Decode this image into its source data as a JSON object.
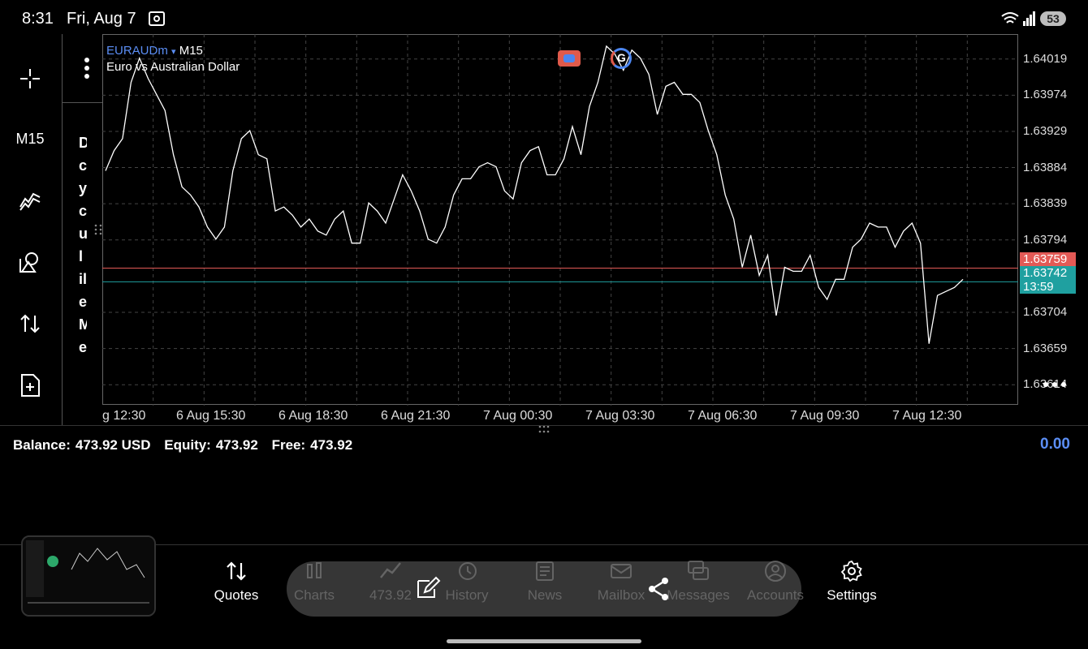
{
  "status_bar": {
    "time": "8:31",
    "date": "Fri, Aug 7",
    "battery": "53"
  },
  "left_toolbar": {
    "timeframe": "M15",
    "tools": [
      "crosshair-icon",
      "indicators-icon",
      "objects-icon",
      "trade-icon",
      "new-document-icon"
    ]
  },
  "side_panel": {
    "clipped_text": "D c y c u l il e M e"
  },
  "chart": {
    "symbol": "EURAUDm",
    "symbol_arrow": "▾",
    "timeframe": "M15",
    "description": "Euro vs Australian Dollar",
    "price_labels": [
      "1.64019",
      "1.63974",
      "1.63929",
      "1.63884",
      "1.63839",
      "1.63794",
      "1.63704",
      "1.63659",
      "1.63614"
    ],
    "ask_price": "1.63759",
    "bid_price": "1.63742",
    "countdown": "13:59",
    "time_labels": [
      "g 12:30",
      "6 Aug 15:30",
      "6 Aug 18:30",
      "6 Aug 21:30",
      "7 Aug 00:30",
      "7 Aug 03:30",
      "7 Aug 06:30",
      "7 Aug 09:30",
      "7 Aug 12:30"
    ],
    "colors": {
      "line": "#ffffff",
      "ask_line": "#e35a56",
      "bid_line": "#1fa0a0",
      "grid": "#444444",
      "symbol": "#5b8ef5"
    }
  },
  "chart_data": {
    "type": "line",
    "title": "",
    "xlabel": "",
    "ylabel": "",
    "ylim": [
      1.6359,
      1.6405
    ],
    "series": [
      {
        "values": [
          1.6388,
          1.63905,
          1.6392,
          1.6399,
          1.6402,
          1.63995,
          1.63975,
          1.63955,
          1.639,
          1.6386,
          1.6385,
          1.63835,
          1.6381,
          1.63795,
          1.6381,
          1.6388,
          1.6392,
          1.6393,
          1.639,
          1.63895,
          1.6383,
          1.63835,
          1.63825,
          1.6381,
          1.6382,
          1.63805,
          1.638,
          1.6382,
          1.6383,
          1.6379,
          1.6379,
          1.6384,
          1.6383,
          1.63815,
          1.63845,
          1.63875,
          1.63855,
          1.6383,
          1.63795,
          1.6379,
          1.6381,
          1.6385,
          1.6387,
          1.6387,
          1.63885,
          1.6389,
          1.63885,
          1.63855,
          1.63845,
          1.6389,
          1.63905,
          1.6391,
          1.63875,
          1.63875,
          1.63895,
          1.63935,
          1.639,
          1.6396,
          1.6399,
          1.64035,
          1.64025,
          1.64005,
          1.6403,
          1.6402,
          1.64,
          1.6395,
          1.63985,
          1.6399,
          1.63975,
          1.63975,
          1.63965,
          1.6393,
          1.639,
          1.6385,
          1.6382,
          1.6376,
          1.638,
          1.6375,
          1.63775,
          1.637,
          1.6376,
          1.63755,
          1.63755,
          1.63775,
          1.63735,
          1.6372,
          1.63745,
          1.63745,
          1.63785,
          1.63795,
          1.63815,
          1.6381,
          1.6381,
          1.63785,
          1.63805,
          1.63815,
          1.6379,
          1.63665,
          1.63725,
          1.6373,
          1.63735,
          1.63745
        ]
      }
    ],
    "x_ticks": [
      "g 12:30",
      "6 Aug 15:30",
      "6 Aug 18:30",
      "6 Aug 21:30",
      "7 Aug 00:30",
      "7 Aug 03:30",
      "7 Aug 06:30",
      "7 Aug 09:30",
      "7 Aug 12:30"
    ],
    "y_ticks": [
      1.64019,
      1.63974,
      1.63929,
      1.63884,
      1.63839,
      1.63794,
      1.63704,
      1.63659,
      1.63614
    ],
    "grid": true,
    "ask": 1.63759,
    "bid": 1.63742
  },
  "account": {
    "balance_label": "Balance:",
    "balance_value": "473.92 USD",
    "equity_label": "Equity:",
    "equity_value": "473.92",
    "free_label": "Free:",
    "free_value": "473.92",
    "profit": "0.00"
  },
  "nav": {
    "quotes": "Quotes",
    "charts": "Charts",
    "trade": "473.92",
    "history": "History",
    "news": "News",
    "mailbox": "Mailbox",
    "messages": "Messages",
    "accounts": "Accounts",
    "settings": "Settings"
  }
}
